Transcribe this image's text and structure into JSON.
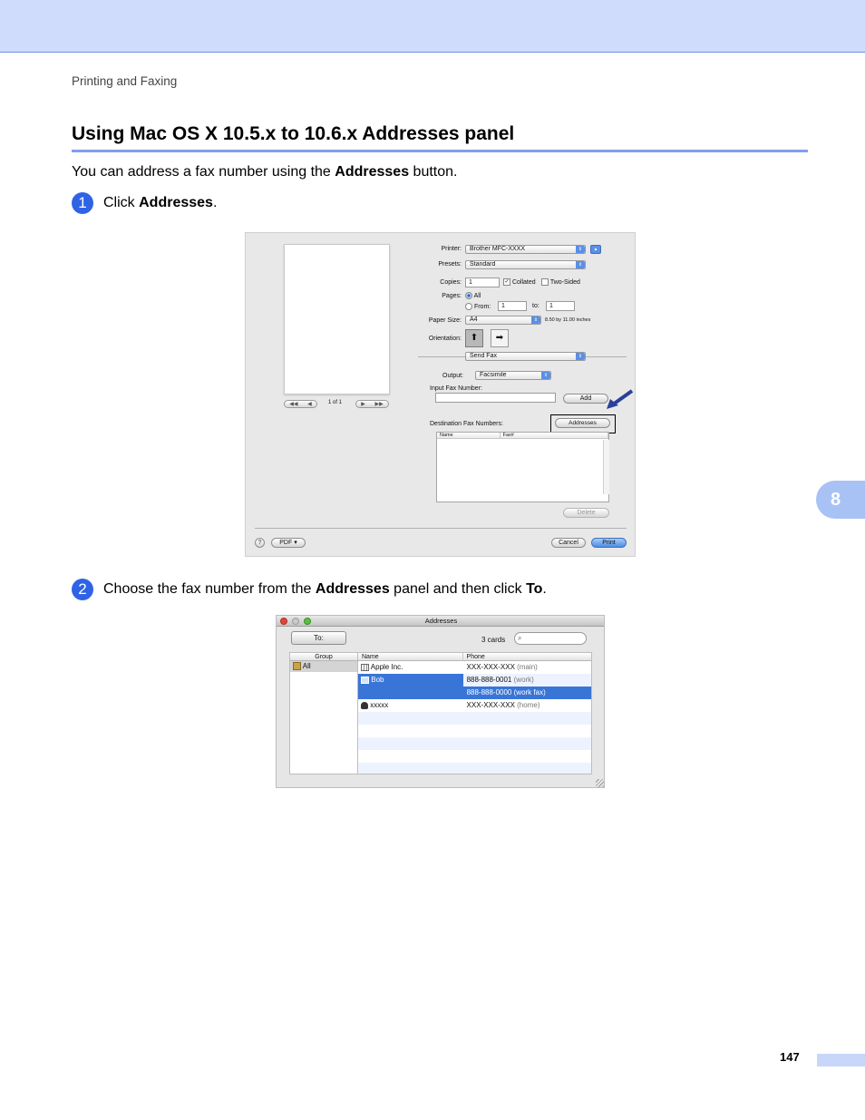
{
  "page": {
    "section": "Printing and Faxing",
    "heading": "Using Mac OS X 10.5.x to 10.6.x Addresses panel",
    "intro": {
      "before": "You can address a fax number using the ",
      "bold": "Addresses",
      "after": " button."
    },
    "step1": {
      "number": "1",
      "before": "Click ",
      "bold": "Addresses",
      "after": "."
    },
    "step2": {
      "number": "2",
      "before": "Choose the fax number from the ",
      "bold1": "Addresses",
      "middle": " panel and then click ",
      "bold2": "To",
      "after": "."
    },
    "chapter_tab": "8",
    "page_number": "147"
  },
  "print_dialog": {
    "pager": {
      "first": "◀◀",
      "prev": "◀",
      "page_label": "1 of 1",
      "next": "▶",
      "last": "▶▶"
    },
    "printer": {
      "label": "Printer:",
      "value": "Brother MFC-XXXX",
      "expand": "▲"
    },
    "presets": {
      "label": "Presets:",
      "value": "Standard"
    },
    "copies": {
      "label": "Copies:",
      "value": "1",
      "collated": "Collated",
      "two_sided": "Two-Sided"
    },
    "pages": {
      "label": "Pages:",
      "all": "All",
      "from": "From:",
      "from_value": "1",
      "to": "to:",
      "to_value": "1"
    },
    "paper_size": {
      "label": "Paper Size:",
      "value": "A4",
      "dims": "8.50 by 11.00 inches"
    },
    "orientation": {
      "label": "Orientation:"
    },
    "section_popup": "Send Fax",
    "output": {
      "label": "Output:",
      "value": "Facsimile"
    },
    "input_fax": {
      "label": "Input Fax Number:",
      "value": ""
    },
    "add_button": "Add",
    "dest_label": "Destination Fax Numbers:",
    "addresses_button": "Addresses",
    "list_columns": [
      "Name",
      "Fax#"
    ],
    "delete_button": "Delete",
    "help": "?",
    "pdf_button": "PDF ▾",
    "cancel_button": "Cancel",
    "print_button": "Print"
  },
  "addresses_panel": {
    "title": "Addresses",
    "to_button": "To:",
    "card_count": "3 cards",
    "search_placeholder": "",
    "columns": {
      "group": "Group",
      "name": "Name",
      "phone": "Phone"
    },
    "group_item": "All",
    "rows": [
      {
        "name": "Apple Inc.",
        "phone": "XXX-XXX-XXX",
        "type": "(main)"
      },
      {
        "name": "Bob",
        "phone": "888-888-0001",
        "type": "(work)"
      },
      {
        "name": "",
        "phone": "888-888-0000",
        "type": "(work fax)"
      },
      {
        "name": "xxxxx",
        "phone": "XXX-XXX-XXX",
        "type": "(home)"
      }
    ]
  },
  "colors": {
    "accent": "#2f63e6",
    "band": "#cfdcfc",
    "rule": "#7f9ef0",
    "selection": "#3875d7"
  }
}
